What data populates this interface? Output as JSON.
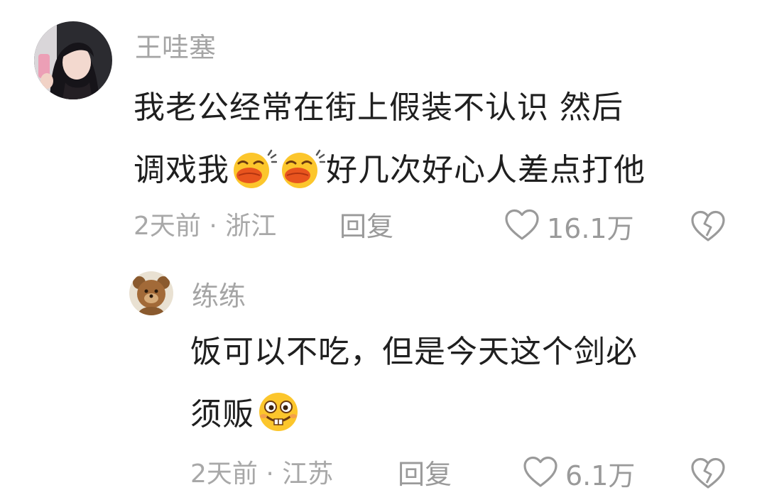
{
  "comments": [
    {
      "username": "王哇塞",
      "text_line1": "我老公经常在街上假装不认识 然后",
      "text_line2_before": "调戏我",
      "text_line2_after": "好几次好心人差点打他",
      "emojis": [
        "kiss-face-emoji",
        "kiss-face-emoji"
      ],
      "time": "2天前",
      "separator": "·",
      "location": "浙江",
      "reply_label": "回复",
      "likes": "16.1万",
      "icons": {
        "like": "heart-icon",
        "dislike": "broken-heart-icon"
      }
    },
    {
      "username": "练练",
      "text_line1": "饭可以不吃，但是今天这个剑必",
      "text_line2_before": "须贩",
      "emojis": [
        "buck-teeth-grin-emoji"
      ],
      "time": "2天前",
      "separator": "·",
      "location": "江苏",
      "reply_label": "回复",
      "likes": "6.1万",
      "icons": {
        "like": "heart-icon",
        "dislike": "broken-heart-icon"
      }
    }
  ]
}
